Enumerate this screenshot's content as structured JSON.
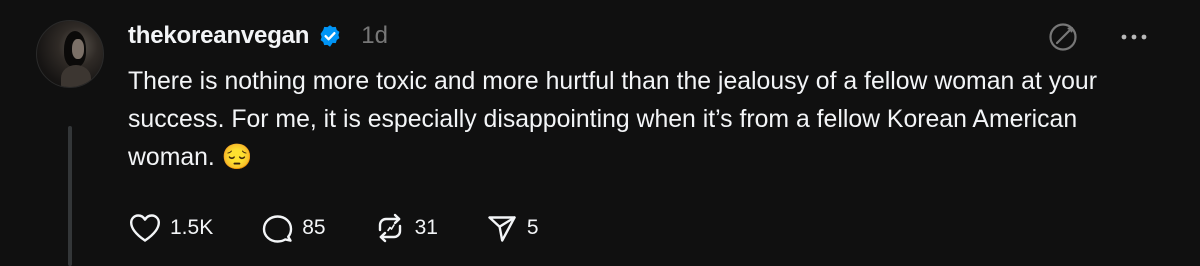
{
  "post": {
    "username": "thekoreanvegan",
    "timestamp": "1d",
    "text": "There is nothing more toxic and more hurtful than the jealousy of a fellow woman at your success. For me, it is especially disappointing when it’s from a fellow Korean American woman. 😔",
    "verified": true
  },
  "actions": {
    "likes": "1.5K",
    "replies": "85",
    "reposts": "31",
    "shares": "5"
  },
  "icons": {
    "like": "heart-icon",
    "reply": "comment-bubble-icon",
    "repost": "repost-icon",
    "share": "send-icon",
    "verified": "verified-badge-icon",
    "translate": "translate-icon",
    "more": "more-dots-icon"
  },
  "colors": {
    "background": "#101010",
    "text": "#f3f5f7",
    "muted": "#777777",
    "verified": "#0095f6"
  }
}
